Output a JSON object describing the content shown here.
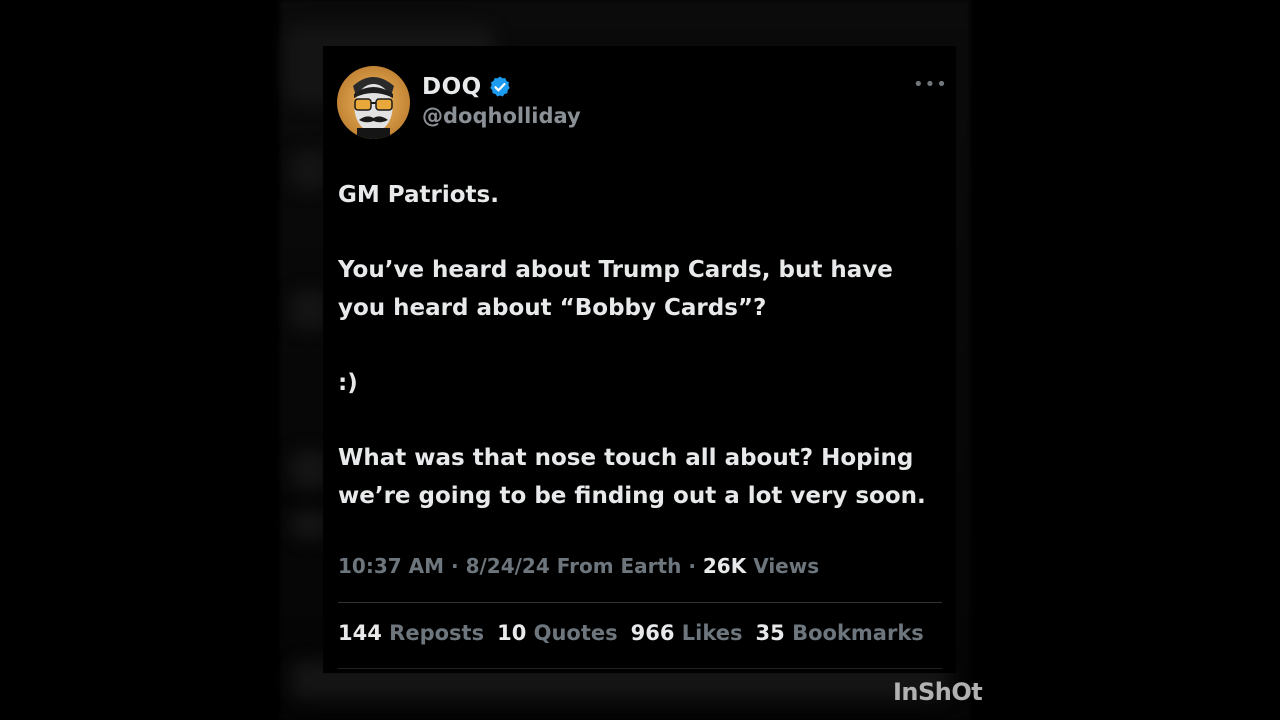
{
  "post": {
    "author_name": "DOQ",
    "author_handle": "@doqholliday",
    "verified": true,
    "more_icon": "more-horizontal-icon",
    "paragraphs": [
      "GM Patriots.",
      "You’ve heard about Trump Cards, but have\nyou heard about “Bobby Cards”?",
      ":)",
      "What was that nose touch all about? Hoping\nwe’re going to be finding out a lot very soon."
    ],
    "time": "10:37 AM",
    "date": "8/24/24",
    "source": "From Earth",
    "views_count": "26K",
    "views_label": "Views",
    "separator": "·"
  },
  "stats": [
    {
      "count": "144",
      "label": "Reposts"
    },
    {
      "count": "10",
      "label": "Quotes"
    },
    {
      "count": "966",
      "label": "Likes"
    },
    {
      "count": "35",
      "label": "Bookmarks"
    }
  ],
  "colors": {
    "background": "#000000",
    "text_primary": "#e7e9ea",
    "text_secondary": "#6e767d",
    "verified_blue": "#1d9bf0"
  },
  "watermark": "InShOt"
}
